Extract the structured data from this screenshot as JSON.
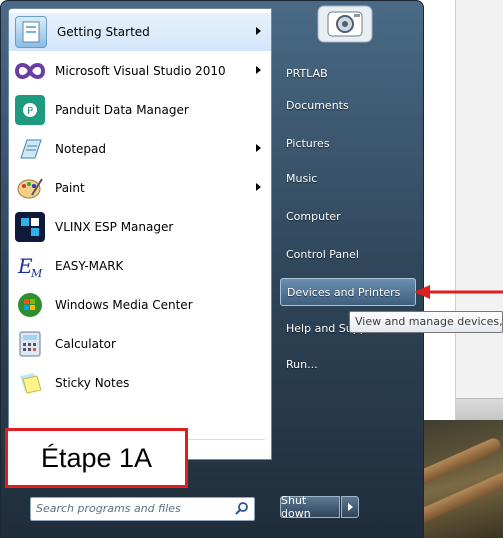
{
  "start_menu": {
    "programs": [
      {
        "label": "Getting Started",
        "icon": "getting-started-icon",
        "has_submenu": true,
        "highlighted": true
      },
      {
        "label": "Microsoft Visual Studio 2010",
        "icon": "visual-studio-icon",
        "has_submenu": true
      },
      {
        "label": "Panduit Data Manager",
        "icon": "panduit-icon",
        "has_submenu": false
      },
      {
        "label": "Notepad",
        "icon": "notepad-icon",
        "has_submenu": true
      },
      {
        "label": "Paint",
        "icon": "paint-icon",
        "has_submenu": true
      },
      {
        "label": "VLINX ESP Manager",
        "icon": "vlinx-icon",
        "has_submenu": false
      },
      {
        "label": "EASY-MARK",
        "icon": "easy-mark-icon",
        "has_submenu": false
      },
      {
        "label": "Windows Media Center",
        "icon": "media-center-icon",
        "has_submenu": false
      },
      {
        "label": "Calculator",
        "icon": "calculator-icon",
        "has_submenu": false
      },
      {
        "label": "Sticky Notes",
        "icon": "sticky-notes-icon",
        "has_submenu": false
      }
    ],
    "search": {
      "placeholder": "Search programs and files"
    },
    "right_items": [
      {
        "label": "PRTLAB"
      },
      {
        "label": "Documents"
      },
      {
        "label": "Pictures"
      },
      {
        "label": "Music"
      },
      {
        "label": "Computer"
      },
      {
        "label": "Control Panel"
      },
      {
        "label": "Devices and Printers",
        "active": true
      },
      {
        "label": "Help and Support"
      },
      {
        "label": "Run..."
      }
    ],
    "shutdown_label": "Shut down"
  },
  "tooltip": {
    "text": "View and manage devices, p"
  },
  "annotation": {
    "step_label": "Étape 1A",
    "color": "#e01e1e"
  }
}
